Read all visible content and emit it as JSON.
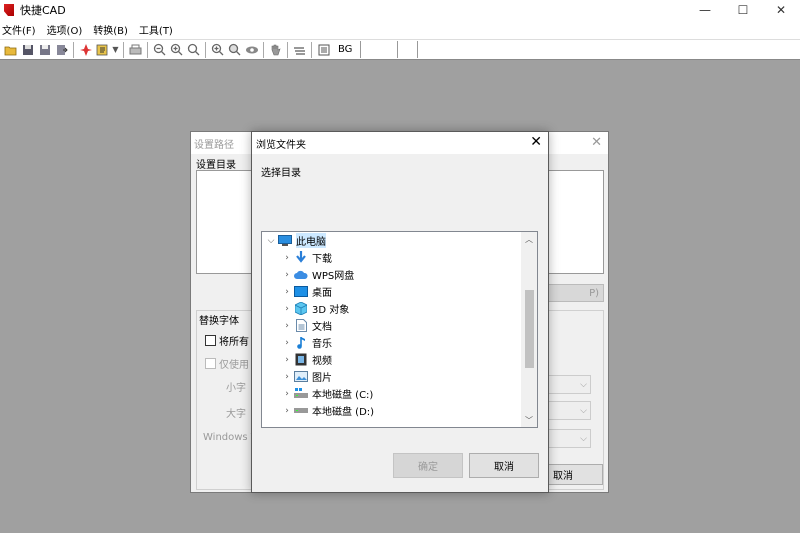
{
  "app": {
    "title": "快捷CAD"
  },
  "window_controls": {
    "minimize": "—",
    "maximize": "☐",
    "close": "✕"
  },
  "menu": [
    "文件(F)",
    "选项(O)",
    "转换(B)",
    "工具(T)"
  ],
  "toolbar": {
    "bg_label": "BG"
  },
  "back_dialog": {
    "title": "设置路径",
    "label": "设置目录",
    "right_button_fragment": "P)",
    "group_label": "替换字体",
    "check_all": "将所有",
    "check_only": "仅使用",
    "small_font": "小字",
    "big_font": "大字",
    "windows_font": "Windows T",
    "cancel": "取消"
  },
  "dialog": {
    "title": "浏览文件夹",
    "prompt": "选择目录",
    "tree": [
      {
        "label": "此电脑",
        "icon": "computer-icon",
        "selected": true,
        "expanded": true
      },
      {
        "label": "下载",
        "icon": "download-arrow-icon"
      },
      {
        "label": "WPS网盘",
        "icon": "cloud-icon"
      },
      {
        "label": "桌面",
        "icon": "desktop-icon"
      },
      {
        "label": "3D 对象",
        "icon": "cube-icon"
      },
      {
        "label": "文档",
        "icon": "document-icon"
      },
      {
        "label": "音乐",
        "icon": "music-note-icon"
      },
      {
        "label": "视频",
        "icon": "video-icon"
      },
      {
        "label": "图片",
        "icon": "picture-icon"
      },
      {
        "label": "本地磁盘 (C:)",
        "icon": "drive-c-icon"
      },
      {
        "label": "本地磁盘 (D:)",
        "icon": "drive-icon"
      }
    ],
    "ok": "确定",
    "cancel": "取消"
  }
}
